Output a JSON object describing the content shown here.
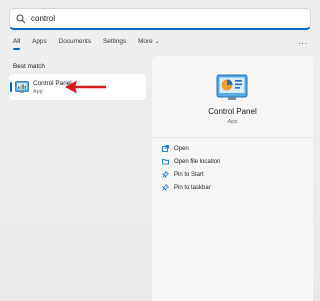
{
  "search": {
    "value": "control",
    "placeholder": ""
  },
  "tabs": [
    {
      "label": "All",
      "active": true
    },
    {
      "label": "Apps"
    },
    {
      "label": "Documents"
    },
    {
      "label": "Settings"
    },
    {
      "label": "More"
    }
  ],
  "more_menu": "...",
  "best_match": {
    "label": "Best match",
    "title": "Control Panel",
    "subtitle": "App"
  },
  "detail": {
    "title": "Control Panel",
    "subtitle": "App",
    "actions": [
      {
        "label": "Open",
        "icon": "open-icon"
      },
      {
        "label": "Open file location",
        "icon": "folder-icon"
      },
      {
        "label": "Pin to Start",
        "icon": "pin-icon"
      },
      {
        "label": "Pin to taskbar",
        "icon": "pin-icon"
      }
    ]
  },
  "colors": {
    "accent": "#0067c0",
    "arrow": "#d11a1a"
  }
}
